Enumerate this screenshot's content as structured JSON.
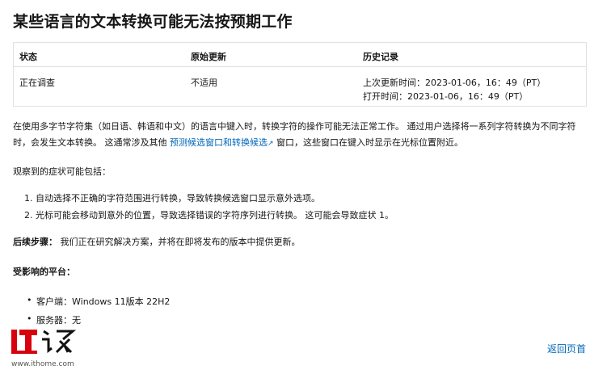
{
  "title": "某些语言的文本转换可能无法按预期工作",
  "status_table": {
    "headers": [
      "状态",
      "原始更新",
      "历史记录"
    ],
    "status": "正在调查",
    "original_update": "不适用",
    "history_line1": "上次更新时间：2023-01-06，16：49（PT）",
    "history_line2": "打开时间：2023-01-06，16：49（PT）"
  },
  "intro": {
    "part1": "在使用多字节字符集（如日语、韩语和中文）的语言中键入时，转换字符的操作可能无法正常工作。 通过用户选择将一系列字符转换为不同字符时，会发生文本转换。 这通常涉及其他",
    "link": "预测候选窗口和转换候选",
    "part2": "窗口，这些窗口在键入时显示在光标位置附近。"
  },
  "symptoms_intro": "观察到的症状可能包括：",
  "symptoms": [
    "1. 自动选择不正确的字符范围进行转换，导致转换候选窗口显示意外选项。",
    "2. 光标可能会移动到意外的位置，导致选择错误的字符序列进行转换。 这可能会导致症状 1。"
  ],
  "next_steps": {
    "label": "后续步骤：",
    "text": "我们正在研究解决方案，并将在即将发布的版本中提供更新。"
  },
  "platforms": {
    "label": "受影响的平台：",
    "items": [
      "客户端：Windows 11版本 22H2",
      "服务器：无"
    ]
  },
  "back_to_top": "返回页首",
  "watermark": {
    "logo_text": "IT之家",
    "url": "www.ithome.com"
  }
}
